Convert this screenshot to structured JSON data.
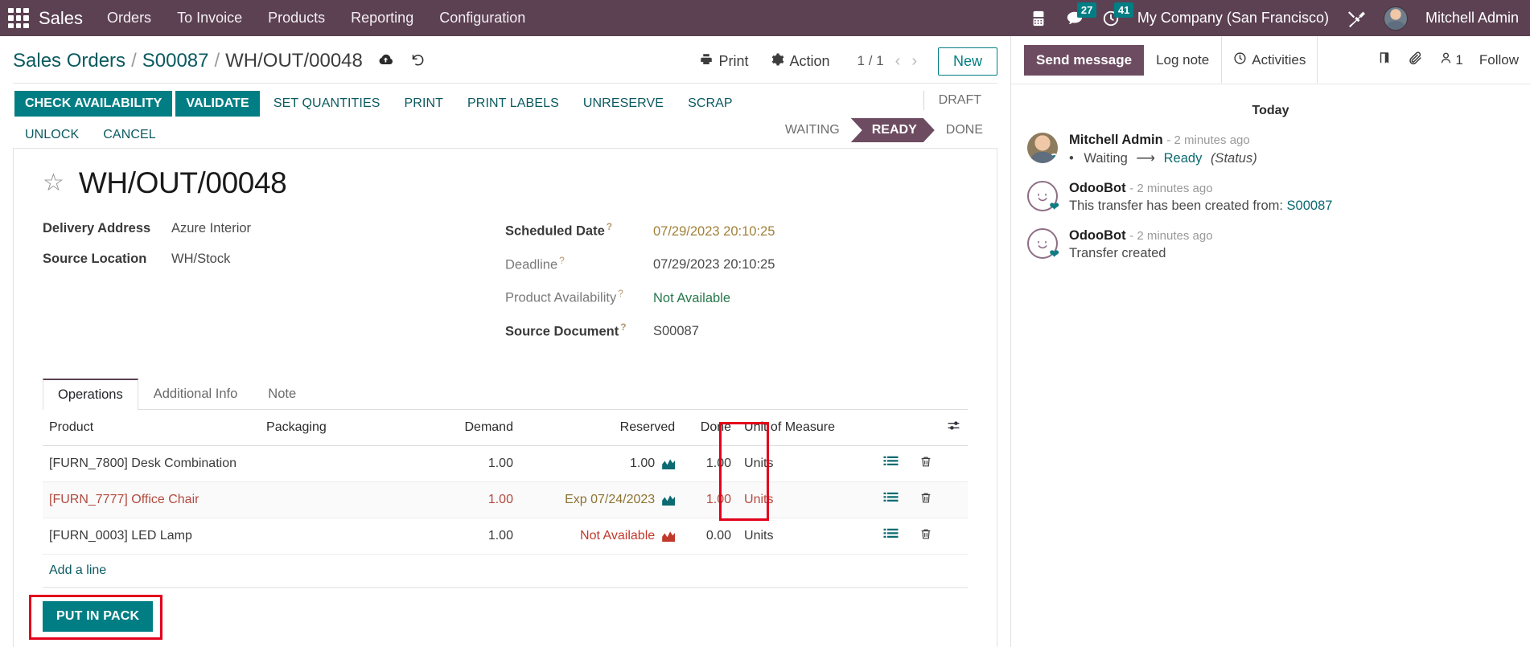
{
  "navbar": {
    "apps_icon": "apps-grid-icon",
    "brand": "Sales",
    "menu": [
      {
        "label": "Orders"
      },
      {
        "label": "To Invoice"
      },
      {
        "label": "Products"
      },
      {
        "label": "Reporting"
      },
      {
        "label": "Configuration"
      }
    ],
    "phone_icon": "phone-icon",
    "messages_icon": "messages-icon",
    "messages_count": "27",
    "activities_icon": "clock-icon",
    "activities_count": "41",
    "company": "My Company (San Francisco)",
    "debug_icon": "tools-icon",
    "user": "Mitchell Admin"
  },
  "control_panel": {
    "breadcrumb": [
      {
        "label": "Sales Orders",
        "type": "link"
      },
      {
        "label": "S00087",
        "type": "link"
      },
      {
        "label": "WH/OUT/00048",
        "type": "active"
      }
    ],
    "separator": "/",
    "save_icon": "cloud-upload-icon",
    "discard_icon": "undo-icon",
    "print_label": "Print",
    "print_icon": "printer-icon",
    "action_label": "Action",
    "action_icon": "gear-icon",
    "pager": "1 / 1",
    "prev_icon": "chevron-left-icon",
    "next_icon": "chevron-right-icon",
    "new_label": "New"
  },
  "buttons": {
    "row1": [
      {
        "label": "CHECK AVAILABILITY",
        "style": "primary"
      },
      {
        "label": "VALIDATE",
        "style": "primary"
      },
      {
        "label": "SET QUANTITIES",
        "style": "ghost"
      },
      {
        "label": "PRINT",
        "style": "ghost"
      },
      {
        "label": "PRINT LABELS",
        "style": "ghost"
      },
      {
        "label": "UNRESERVE",
        "style": "ghost"
      },
      {
        "label": "SCRAP",
        "style": "ghost"
      }
    ],
    "row2": [
      {
        "label": "UNLOCK",
        "style": "ghost"
      },
      {
        "label": "CANCEL",
        "style": "ghost"
      }
    ]
  },
  "statusbar": {
    "draft": "DRAFT",
    "steps": [
      {
        "label": "WAITING",
        "active": false
      },
      {
        "label": "READY",
        "active": true
      },
      {
        "label": "DONE",
        "active": false
      }
    ]
  },
  "form": {
    "star_icon": "star-outline-icon",
    "title": "WH/OUT/00048",
    "left_fields": [
      {
        "label": "Delivery Address",
        "value": "Azure Interior",
        "bold": true,
        "help": false
      },
      {
        "label": "Source Location",
        "value": "WH/Stock",
        "bold": true,
        "help": false
      }
    ],
    "right_fields": [
      {
        "label": "Scheduled Date",
        "value": "07/29/2023 20:10:25",
        "bold": true,
        "help": true,
        "value_class": "date-warn"
      },
      {
        "label": "Deadline",
        "value": "07/29/2023 20:10:25",
        "bold": false,
        "help": true,
        "value_class": ""
      },
      {
        "label": "Product Availability",
        "value": "Not Available",
        "bold": false,
        "help": true,
        "value_class": "green"
      },
      {
        "label": "Source Document",
        "value": "S00087",
        "bold": true,
        "help": true,
        "value_class": ""
      }
    ]
  },
  "notebook": {
    "tabs": [
      {
        "label": "Operations",
        "active": true
      },
      {
        "label": "Additional Info",
        "active": false
      },
      {
        "label": "Note",
        "active": false
      }
    ]
  },
  "table": {
    "headers": {
      "product": "Product",
      "packaging": "Packaging",
      "demand": "Demand",
      "reserved": "Reserved",
      "done": "Done",
      "uom": "Unit of Measure",
      "options_icon": "sliders-icon"
    },
    "rows": [
      {
        "product": "[FURN_7800] Desk Combination",
        "packaging": "",
        "demand": "1.00",
        "reserved": "1.00",
        "reserved_icon": "forecast-teal-icon",
        "done": "1.00",
        "uom": "Units",
        "state": "normal",
        "list_icon": "detailed-operations-icon",
        "delete_icon": "trash-icon"
      },
      {
        "product": "[FURN_7777] Office Chair",
        "packaging": "",
        "demand": "1.00",
        "reserved": "Exp 07/24/2023",
        "reserved_icon": "forecast-teal-icon",
        "done": "1.00",
        "uom": "Units",
        "state": "late",
        "list_icon": "detailed-operations-icon",
        "delete_icon": "trash-icon"
      },
      {
        "product": "[FURN_0003] LED Lamp",
        "packaging": "",
        "demand": "1.00",
        "reserved": "Not Available",
        "reserved_icon": "forecast-red-icon",
        "done": "0.00",
        "uom": "Units",
        "state": "unavailable",
        "list_icon": "detailed-operations-icon",
        "delete_icon": "trash-icon"
      }
    ],
    "add_line": "Add a line"
  },
  "pack": {
    "put_in_pack": "PUT IN PACK"
  },
  "chatter": {
    "send_message": "Send message",
    "log_note": "Log note",
    "activities": "Activities",
    "activities_icon": "clock-icon",
    "attach_icon": "paperclip-icon",
    "log_icon": "book-icon",
    "followers_icon": "user-icon",
    "followers_count": "1",
    "follow": "Follow",
    "day_separator": "Today",
    "messages": [
      {
        "author": "Mitchell Admin",
        "time": "- 2 minutes ago",
        "avatar": "photo",
        "type": "tracking",
        "old_value": "Waiting",
        "new_value": "Ready",
        "field_name": "(Status)"
      },
      {
        "author": "OdooBot",
        "time": "- 2 minutes ago",
        "avatar": "bot",
        "type": "text",
        "text": "This transfer has been created from: ",
        "link": "S00087"
      },
      {
        "author": "OdooBot",
        "time": "- 2 minutes ago",
        "avatar": "bot",
        "type": "text",
        "text": "Transfer created",
        "link": ""
      }
    ]
  },
  "colors": {
    "navbar_bg": "#5c4153",
    "primary": "#017e84",
    "accent_purple": "#6d4c61",
    "highlight_red": "#e3001b",
    "link_teal": "#0b5a60"
  }
}
